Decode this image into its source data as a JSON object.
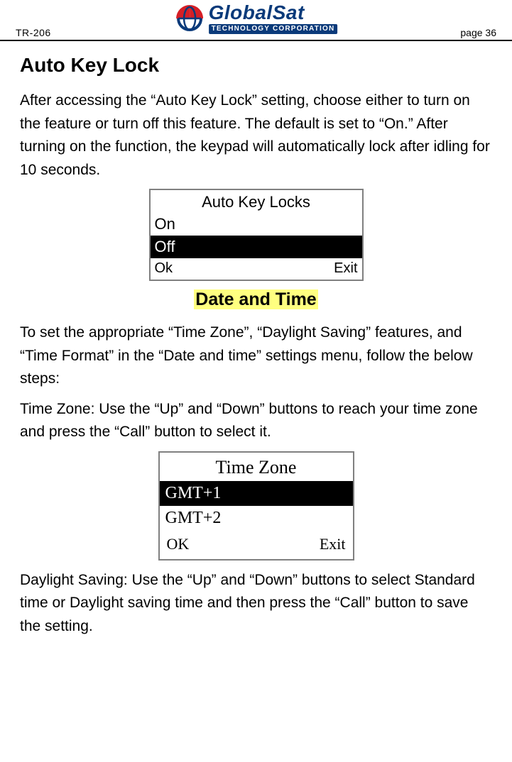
{
  "header": {
    "doc_code": "TR-206",
    "page_label": "page 36",
    "logo": {
      "brand_top": "GlobalSat",
      "brand_bottom": "TECHNOLOGY CORPORATION"
    }
  },
  "section1": {
    "title": "Auto Key Lock",
    "paragraph": "After accessing the “Auto Key Lock” setting, choose either to turn on the feature or turn off this feature. The default is set to “On.” After turning on the function, the keypad will automatically lock after idling for 10 seconds."
  },
  "screen1": {
    "title": "Auto Key Locks",
    "opt_on": "On",
    "opt_off": "Off",
    "soft_left": "Ok",
    "soft_right": "Exit"
  },
  "section2": {
    "title": "Date and Time",
    "paragraph1": "To set the appropriate “Time Zone”, “Daylight Saving” features, and “Time Format” in the “Date and time” settings menu, follow the below steps:",
    "paragraph2": "Time Zone: Use the “Up” and “Down” buttons to reach your time zone and press the “Call” button to select it."
  },
  "screen2": {
    "title": "Time Zone",
    "opt1": "GMT+1",
    "opt2": "GMT+2",
    "soft_left": "OK",
    "soft_right": "Exit"
  },
  "section3": {
    "paragraph": "Daylight Saving: Use the “Up” and “Down” buttons to select Standard time or Daylight saving time and then press the “Call” button to save the setting."
  }
}
